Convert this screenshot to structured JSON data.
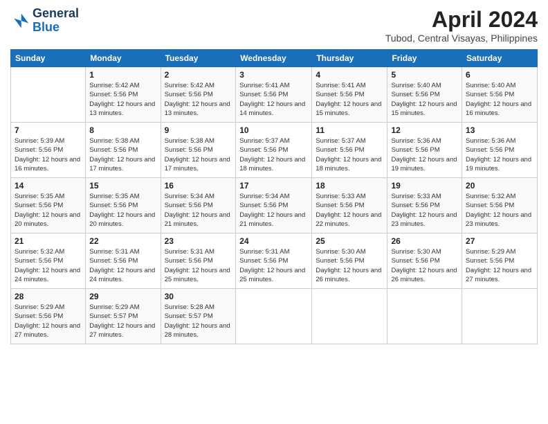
{
  "logo": {
    "line1": "General",
    "line2": "Blue"
  },
  "title": "April 2024",
  "subtitle": "Tubod, Central Visayas, Philippines",
  "weekdays": [
    "Sunday",
    "Monday",
    "Tuesday",
    "Wednesday",
    "Thursday",
    "Friday",
    "Saturday"
  ],
  "weeks": [
    [
      {
        "day": "",
        "sunrise": "",
        "sunset": "",
        "daylight": ""
      },
      {
        "day": "1",
        "sunrise": "Sunrise: 5:42 AM",
        "sunset": "Sunset: 5:56 PM",
        "daylight": "Daylight: 12 hours and 13 minutes."
      },
      {
        "day": "2",
        "sunrise": "Sunrise: 5:42 AM",
        "sunset": "Sunset: 5:56 PM",
        "daylight": "Daylight: 12 hours and 13 minutes."
      },
      {
        "day": "3",
        "sunrise": "Sunrise: 5:41 AM",
        "sunset": "Sunset: 5:56 PM",
        "daylight": "Daylight: 12 hours and 14 minutes."
      },
      {
        "day": "4",
        "sunrise": "Sunrise: 5:41 AM",
        "sunset": "Sunset: 5:56 PM",
        "daylight": "Daylight: 12 hours and 15 minutes."
      },
      {
        "day": "5",
        "sunrise": "Sunrise: 5:40 AM",
        "sunset": "Sunset: 5:56 PM",
        "daylight": "Daylight: 12 hours and 15 minutes."
      },
      {
        "day": "6",
        "sunrise": "Sunrise: 5:40 AM",
        "sunset": "Sunset: 5:56 PM",
        "daylight": "Daylight: 12 hours and 16 minutes."
      }
    ],
    [
      {
        "day": "7",
        "sunrise": "Sunrise: 5:39 AM",
        "sunset": "Sunset: 5:56 PM",
        "daylight": "Daylight: 12 hours and 16 minutes."
      },
      {
        "day": "8",
        "sunrise": "Sunrise: 5:38 AM",
        "sunset": "Sunset: 5:56 PM",
        "daylight": "Daylight: 12 hours and 17 minutes."
      },
      {
        "day": "9",
        "sunrise": "Sunrise: 5:38 AM",
        "sunset": "Sunset: 5:56 PM",
        "daylight": "Daylight: 12 hours and 17 minutes."
      },
      {
        "day": "10",
        "sunrise": "Sunrise: 5:37 AM",
        "sunset": "Sunset: 5:56 PM",
        "daylight": "Daylight: 12 hours and 18 minutes."
      },
      {
        "day": "11",
        "sunrise": "Sunrise: 5:37 AM",
        "sunset": "Sunset: 5:56 PM",
        "daylight": "Daylight: 12 hours and 18 minutes."
      },
      {
        "day": "12",
        "sunrise": "Sunrise: 5:36 AM",
        "sunset": "Sunset: 5:56 PM",
        "daylight": "Daylight: 12 hours and 19 minutes."
      },
      {
        "day": "13",
        "sunrise": "Sunrise: 5:36 AM",
        "sunset": "Sunset: 5:56 PM",
        "daylight": "Daylight: 12 hours and 19 minutes."
      }
    ],
    [
      {
        "day": "14",
        "sunrise": "Sunrise: 5:35 AM",
        "sunset": "Sunset: 5:56 PM",
        "daylight": "Daylight: 12 hours and 20 minutes."
      },
      {
        "day": "15",
        "sunrise": "Sunrise: 5:35 AM",
        "sunset": "Sunset: 5:56 PM",
        "daylight": "Daylight: 12 hours and 20 minutes."
      },
      {
        "day": "16",
        "sunrise": "Sunrise: 5:34 AM",
        "sunset": "Sunset: 5:56 PM",
        "daylight": "Daylight: 12 hours and 21 minutes."
      },
      {
        "day": "17",
        "sunrise": "Sunrise: 5:34 AM",
        "sunset": "Sunset: 5:56 PM",
        "daylight": "Daylight: 12 hours and 21 minutes."
      },
      {
        "day": "18",
        "sunrise": "Sunrise: 5:33 AM",
        "sunset": "Sunset: 5:56 PM",
        "daylight": "Daylight: 12 hours and 22 minutes."
      },
      {
        "day": "19",
        "sunrise": "Sunrise: 5:33 AM",
        "sunset": "Sunset: 5:56 PM",
        "daylight": "Daylight: 12 hours and 23 minutes."
      },
      {
        "day": "20",
        "sunrise": "Sunrise: 5:32 AM",
        "sunset": "Sunset: 5:56 PM",
        "daylight": "Daylight: 12 hours and 23 minutes."
      }
    ],
    [
      {
        "day": "21",
        "sunrise": "Sunrise: 5:32 AM",
        "sunset": "Sunset: 5:56 PM",
        "daylight": "Daylight: 12 hours and 24 minutes."
      },
      {
        "day": "22",
        "sunrise": "Sunrise: 5:31 AM",
        "sunset": "Sunset: 5:56 PM",
        "daylight": "Daylight: 12 hours and 24 minutes."
      },
      {
        "day": "23",
        "sunrise": "Sunrise: 5:31 AM",
        "sunset": "Sunset: 5:56 PM",
        "daylight": "Daylight: 12 hours and 25 minutes."
      },
      {
        "day": "24",
        "sunrise": "Sunrise: 5:31 AM",
        "sunset": "Sunset: 5:56 PM",
        "daylight": "Daylight: 12 hours and 25 minutes."
      },
      {
        "day": "25",
        "sunrise": "Sunrise: 5:30 AM",
        "sunset": "Sunset: 5:56 PM",
        "daylight": "Daylight: 12 hours and 26 minutes."
      },
      {
        "day": "26",
        "sunrise": "Sunrise: 5:30 AM",
        "sunset": "Sunset: 5:56 PM",
        "daylight": "Daylight: 12 hours and 26 minutes."
      },
      {
        "day": "27",
        "sunrise": "Sunrise: 5:29 AM",
        "sunset": "Sunset: 5:56 PM",
        "daylight": "Daylight: 12 hours and 27 minutes."
      }
    ],
    [
      {
        "day": "28",
        "sunrise": "Sunrise: 5:29 AM",
        "sunset": "Sunset: 5:56 PM",
        "daylight": "Daylight: 12 hours and 27 minutes."
      },
      {
        "day": "29",
        "sunrise": "Sunrise: 5:29 AM",
        "sunset": "Sunset: 5:57 PM",
        "daylight": "Daylight: 12 hours and 27 minutes."
      },
      {
        "day": "30",
        "sunrise": "Sunrise: 5:28 AM",
        "sunset": "Sunset: 5:57 PM",
        "daylight": "Daylight: 12 hours and 28 minutes."
      },
      {
        "day": "",
        "sunrise": "",
        "sunset": "",
        "daylight": ""
      },
      {
        "day": "",
        "sunrise": "",
        "sunset": "",
        "daylight": ""
      },
      {
        "day": "",
        "sunrise": "",
        "sunset": "",
        "daylight": ""
      },
      {
        "day": "",
        "sunrise": "",
        "sunset": "",
        "daylight": ""
      }
    ]
  ]
}
